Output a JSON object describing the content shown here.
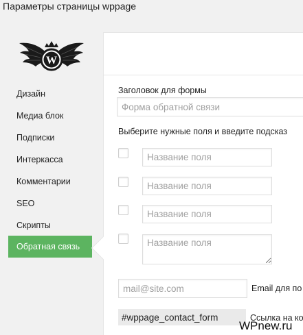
{
  "header": {
    "title": "Параметры страницы wppage"
  },
  "sidebar": {
    "logo_icon": "winged-wordpress-logo",
    "items": [
      {
        "label": "Дизайн"
      },
      {
        "label": "Медиа блок"
      },
      {
        "label": "Подписки"
      },
      {
        "label": "Интеркасса"
      },
      {
        "label": "Комментарии"
      },
      {
        "label": "SEO"
      },
      {
        "label": "Скрипты"
      },
      {
        "label": "Обратная связь",
        "active": true
      }
    ]
  },
  "form": {
    "title_label": "Заголовок для формы",
    "title_placeholder": "Форма обратной связи",
    "fields_hint": "Выберите нужные поля и введите подсказ",
    "fields": [
      {
        "placeholder": "Название поля"
      },
      {
        "placeholder": "Название поля"
      },
      {
        "placeholder": "Название поля"
      },
      {
        "placeholder": "Название поля"
      }
    ],
    "email_placeholder": "mail@site.com",
    "email_label": "Email для по",
    "shortcode": "#wppage_contact_form",
    "shortcode_label": "Ссылка на ко"
  },
  "watermark": "WPnew.ru",
  "colors": {
    "active_nav": "#5cb460",
    "sidebar_bg": "#f1f1f1"
  }
}
